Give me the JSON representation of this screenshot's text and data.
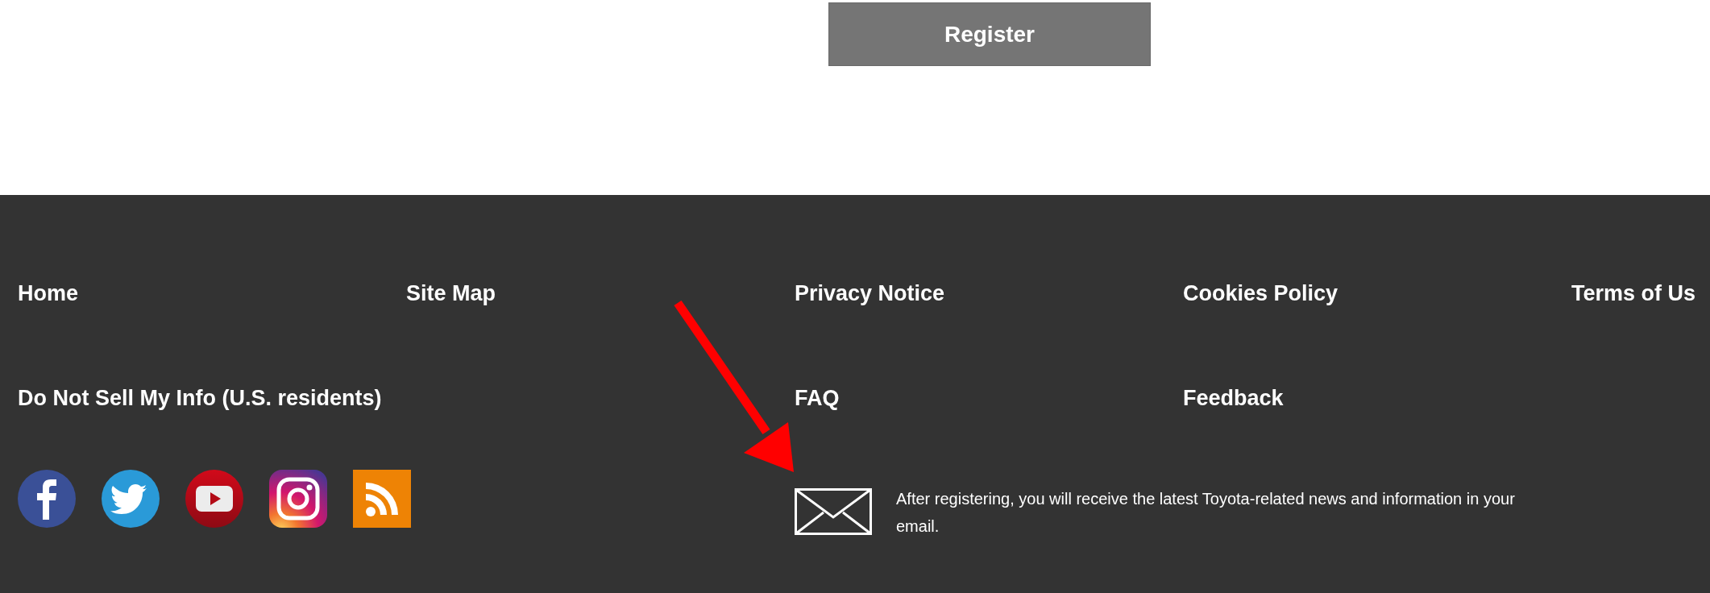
{
  "register_button": {
    "label": "Register"
  },
  "footer": {
    "link_rows": [
      {
        "links": [
          "Home",
          "Site Map",
          "Privacy Notice",
          "Cookies Policy",
          "Terms of Us"
        ]
      },
      {
        "links": [
          "Do Not Sell My Info (U.S. residents)",
          "FAQ",
          "Feedback"
        ]
      }
    ],
    "newsletter": {
      "text": "After registering, you will receive the latest Toyota-related news and information in your email."
    }
  }
}
